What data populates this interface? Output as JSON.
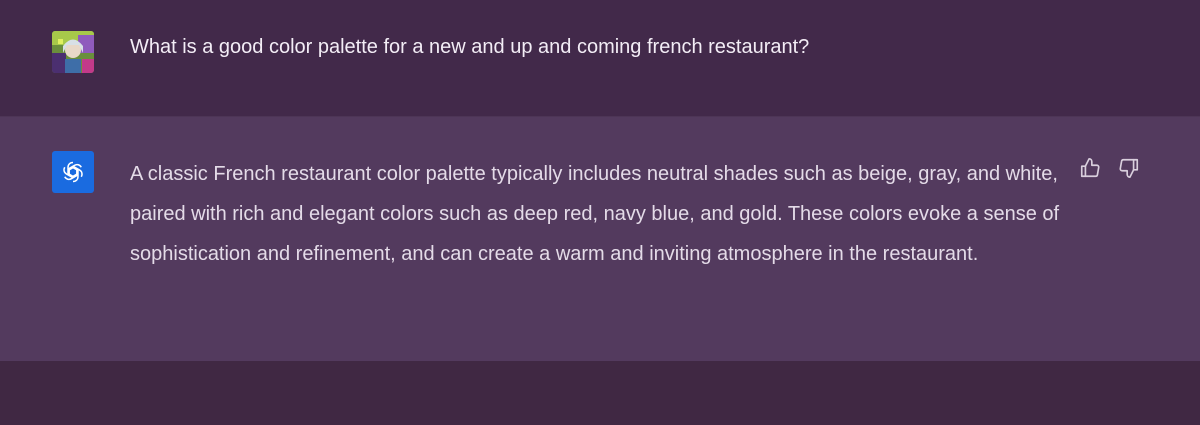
{
  "user_message": {
    "text": "What is a good color palette for a new and up and coming french restaurant?"
  },
  "assistant_message": {
    "text": "A classic French restaurant color palette typically includes neutral shades such as beige, gray, and white, paired with rich and elegant colors such as deep red, navy blue, and gold. These colors evoke a sense of sophistication and refinement, and can create a warm and inviting atmosphere in the restaurant."
  },
  "icons": {
    "user_avatar": "user-avatar",
    "assistant_avatar": "openai-logo-icon",
    "feedback": [
      "thumbs-up-icon",
      "thumbs-down-icon"
    ]
  },
  "colors": {
    "background": "#402843",
    "user_row": "#42294a",
    "assistant_row": "#533a5e",
    "assistant_avatar_bg": "#1a6be0",
    "text": "#e4dbe8"
  }
}
